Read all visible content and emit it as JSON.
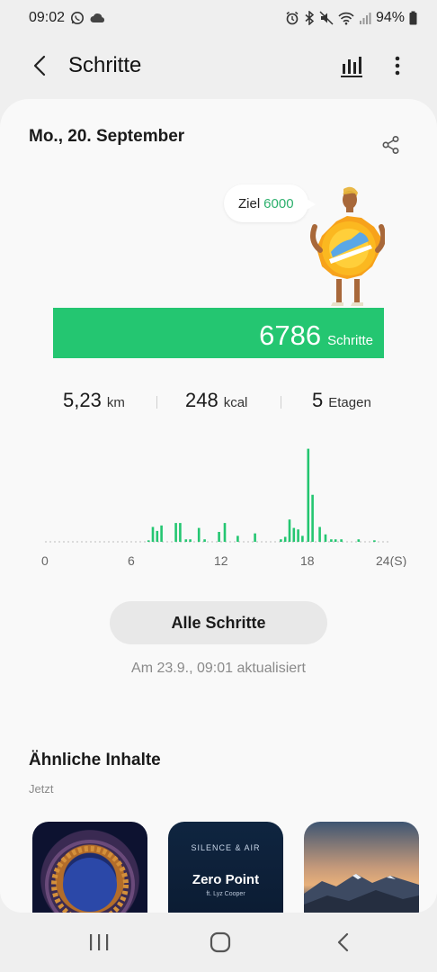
{
  "status_bar": {
    "time": "09:02",
    "battery": "94%",
    "icons": [
      "whatsapp-icon",
      "cloud-icon",
      "alarm-icon",
      "bluetooth-icon",
      "mute-icon",
      "wifi-icon",
      "signal-icon",
      "battery-icon"
    ]
  },
  "app_bar": {
    "title": "Schritte",
    "back_icon": "back-arrow-icon",
    "chart_icon": "bar-chart-icon",
    "more_icon": "more-vert-icon"
  },
  "day": {
    "date": "Mo., 20. September",
    "goal_label": "Ziel",
    "goal_value": "6000",
    "steps": "6786",
    "steps_unit": "Schritte",
    "goal_reached_fraction": 1.0
  },
  "stats": [
    {
      "value": "5,23",
      "unit": "km"
    },
    {
      "value": "248",
      "unit": "kcal"
    },
    {
      "value": "5",
      "unit": "Etagen"
    }
  ],
  "chart_data": {
    "type": "bar",
    "xlabels": [
      "0",
      "6",
      "12",
      "18",
      "24(S)"
    ],
    "xlim": [
      0,
      24
    ],
    "bars": [
      {
        "x": 7.2,
        "v": 3
      },
      {
        "x": 7.5,
        "v": 30
      },
      {
        "x": 7.8,
        "v": 22
      },
      {
        "x": 8.1,
        "v": 33
      },
      {
        "x": 9.1,
        "v": 38
      },
      {
        "x": 9.4,
        "v": 38
      },
      {
        "x": 9.8,
        "v": 5
      },
      {
        "x": 10.1,
        "v": 5
      },
      {
        "x": 10.7,
        "v": 28
      },
      {
        "x": 11.1,
        "v": 5
      },
      {
        "x": 12.1,
        "v": 20
      },
      {
        "x": 12.5,
        "v": 38
      },
      {
        "x": 13.4,
        "v": 12
      },
      {
        "x": 14.6,
        "v": 17
      },
      {
        "x": 16.4,
        "v": 5
      },
      {
        "x": 16.7,
        "v": 10
      },
      {
        "x": 17.0,
        "v": 45
      },
      {
        "x": 17.3,
        "v": 28
      },
      {
        "x": 17.6,
        "v": 25
      },
      {
        "x": 17.9,
        "v": 12
      },
      {
        "x": 18.3,
        "v": 188
      },
      {
        "x": 18.6,
        "v": 95
      },
      {
        "x": 19.1,
        "v": 30
      },
      {
        "x": 19.5,
        "v": 15
      },
      {
        "x": 19.9,
        "v": 5
      },
      {
        "x": 20.2,
        "v": 5
      },
      {
        "x": 20.6,
        "v": 5
      },
      {
        "x": 21.8,
        "v": 5
      },
      {
        "x": 22.9,
        "v": 3
      }
    ],
    "ylim": [
      0,
      200
    ],
    "color": "#24c671"
  },
  "actions": {
    "all_steps": "Alle Schritte",
    "updated": "Am 23.9., 09:01 aktualisiert"
  },
  "similar": {
    "title": "Ähnliche Inhalte",
    "subtitle": "Jetzt",
    "items": [
      {
        "brand": "",
        "title": "",
        "sub": ""
      },
      {
        "brand": "SILENCE & AIR",
        "title": "Zero Point",
        "sub": "ft. Lyz Cooper"
      },
      {
        "brand": "",
        "title": "",
        "sub": ""
      }
    ]
  },
  "nav": {
    "recents_icon": "recents-icon",
    "home_icon": "home-icon",
    "back_icon": "nav-back-icon"
  },
  "colors": {
    "accent": "#24c671",
    "goal_text": "#2db06d"
  }
}
